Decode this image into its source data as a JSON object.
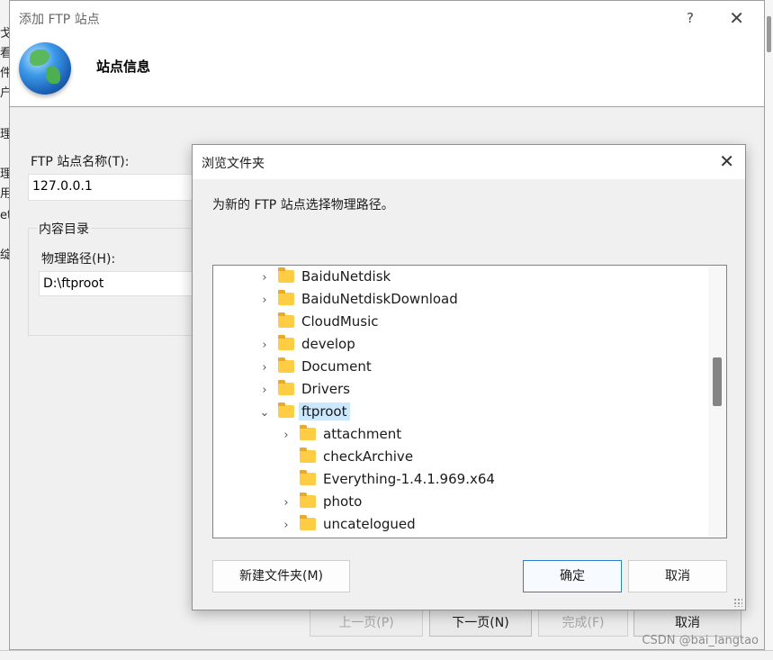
{
  "background": {
    "left_chars": [
      "戈",
      "看",
      "件",
      "户",
      "理",
      "理",
      "用",
      "et",
      "绽"
    ],
    "watermark": "CSDN @bai_langtao"
  },
  "main_window": {
    "title": "添加 FTP 站点",
    "help_label": "?",
    "close_label": "✕",
    "banner_heading": "站点信息",
    "site_name_label": "FTP 站点名称(T):",
    "site_name_value": "127.0.0.1",
    "content_dir_label": "内容目录",
    "physical_path_label": "物理路径(H):",
    "physical_path_value": "D:\\ftproot",
    "buttons": {
      "prev": "上一页(P)",
      "next": "下一页(N)",
      "finish": "完成(F)",
      "cancel": "取消"
    }
  },
  "dialog": {
    "title": "浏览文件夹",
    "close_label": "✕",
    "instruction": "为新的 FTP 站点选择物理路径。",
    "tree": [
      {
        "label": "BaiduNetdisk",
        "expandable": true,
        "expanded": false,
        "level": 0
      },
      {
        "label": "BaiduNetdiskDownload",
        "expandable": true,
        "expanded": false,
        "level": 0
      },
      {
        "label": "CloudMusic",
        "expandable": false,
        "expanded": false,
        "level": 0
      },
      {
        "label": "develop",
        "expandable": true,
        "expanded": false,
        "level": 0
      },
      {
        "label": "Document",
        "expandable": true,
        "expanded": false,
        "level": 0
      },
      {
        "label": "Drivers",
        "expandable": true,
        "expanded": false,
        "level": 0
      },
      {
        "label": "ftproot",
        "expandable": true,
        "expanded": true,
        "selected": true,
        "level": 0
      },
      {
        "label": "attachment",
        "expandable": true,
        "expanded": false,
        "level": 1
      },
      {
        "label": "checkArchive",
        "expandable": false,
        "expanded": false,
        "level": 1
      },
      {
        "label": "Everything-1.4.1.969.x64",
        "expandable": false,
        "expanded": false,
        "level": 1
      },
      {
        "label": "photo",
        "expandable": true,
        "expanded": false,
        "level": 1
      },
      {
        "label": "uncatelogued",
        "expandable": true,
        "expanded": false,
        "level": 1
      }
    ],
    "buttons": {
      "new_folder": "新建文件夹(M)",
      "ok": "确定",
      "cancel": "取消"
    }
  },
  "icons": {
    "folder": "folder-icon",
    "chevron_collapsed": "›",
    "chevron_expanded": "⌄"
  },
  "colors": {
    "selection": "#cce8ff",
    "primary_border": "#2a7fd4",
    "folder": "#ffcd43"
  }
}
